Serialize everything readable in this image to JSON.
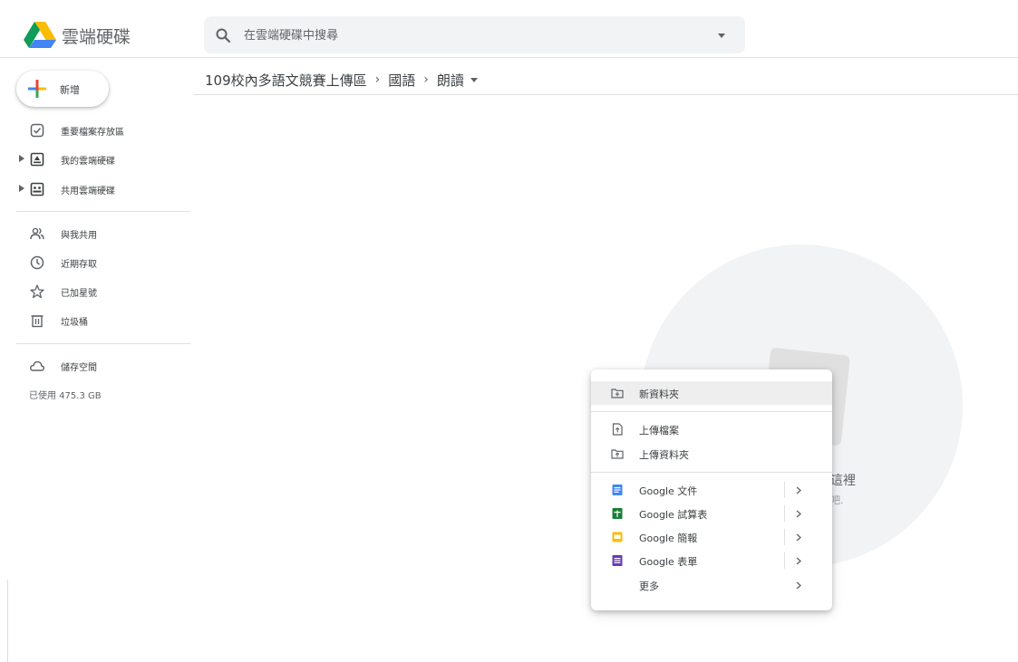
{
  "header": {
    "app_title": "雲端硬碟",
    "search_placeholder": "在雲端硬碟中搜尋"
  },
  "sidebar": {
    "new_label": "新增",
    "items": [
      {
        "label": "重要檔案存放區",
        "icon": "priority-check-icon"
      },
      {
        "label": "我的雲端硬碟",
        "icon": "my-drive-icon"
      },
      {
        "label": "共用雲端硬碟",
        "icon": "shared-drives-icon"
      },
      {
        "label": "與我共用",
        "icon": "people-icon"
      },
      {
        "label": "近期存取",
        "icon": "clock-icon"
      },
      {
        "label": "已加星號",
        "icon": "star-icon"
      },
      {
        "label": "垃圾桶",
        "icon": "trash-icon"
      },
      {
        "label": "儲存空間",
        "icon": "cloud-icon"
      }
    ],
    "storage_used": "已使用 475.3 GB"
  },
  "breadcrumb": {
    "items": [
      "109校內多語文競賽上傳區",
      "國語",
      "朗讀"
    ],
    "separator": "›"
  },
  "empty_state": {
    "line1": "這裡",
    "line2": "吧."
  },
  "context_menu": {
    "items": [
      {
        "label": "新資料夾",
        "icon": "new-folder-icon"
      },
      {
        "label": "上傳檔案",
        "icon": "file-upload-icon"
      },
      {
        "label": "上傳資料夾",
        "icon": "folder-upload-icon"
      },
      {
        "label": "Google 文件",
        "icon": "google-docs-icon"
      },
      {
        "label": "Google 試算表",
        "icon": "google-sheets-icon"
      },
      {
        "label": "Google 簡報",
        "icon": "google-slides-icon"
      },
      {
        "label": "Google 表單",
        "icon": "google-forms-icon"
      },
      {
        "label": "更多",
        "icon": "more-icon"
      }
    ]
  },
  "colors": {
    "docs": "#4285f4",
    "sheets": "#188038",
    "slides": "#fbbc04",
    "forms": "#673ab7"
  }
}
